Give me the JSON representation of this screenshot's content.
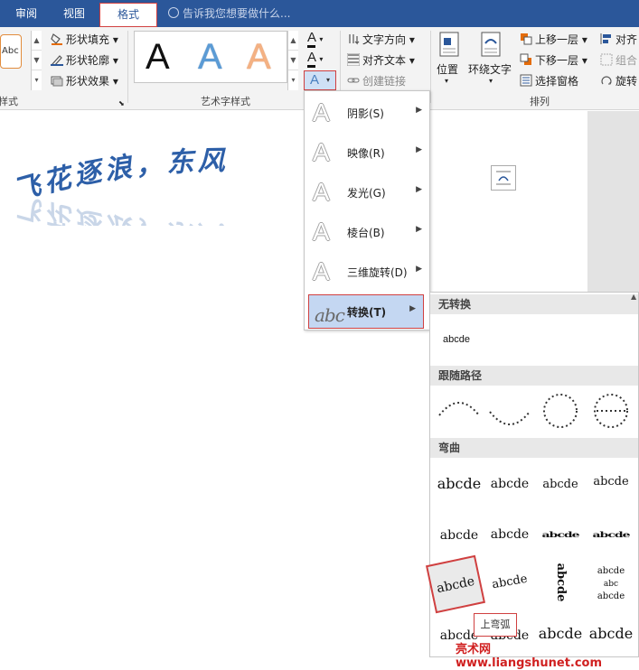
{
  "tabs": [
    {
      "label": "审阅"
    },
    {
      "label": "视图"
    },
    {
      "label": "格式"
    }
  ],
  "tellme": {
    "text": "告诉我您想要做什么..."
  },
  "shape_styles": {
    "preview_label": "Abc",
    "fill_label": "形状填充",
    "outline_label": "形状轮廓",
    "effects_label": "形状效果",
    "group_label": "样式"
  },
  "wordart_styles": {
    "samples": [
      "A",
      "A",
      "A"
    ],
    "group_label": "艺术字样式",
    "text_fill_glyph": "A",
    "text_outline_glyph": "A",
    "text_effects_glyph": "A"
  },
  "text_group": {
    "direction_label": "文字方向",
    "align_label": "对齐文本",
    "link_label": "创建链接"
  },
  "arrange": {
    "position_label": "位置",
    "wrap_label": "环绕文字",
    "forward_label": "上移一层",
    "backward_label": "下移一层",
    "selection_pane_label": "选择窗格",
    "align_label": "对齐",
    "group_label": "组合",
    "rotate_label": "旋转",
    "section_label": "排列"
  },
  "effects_menu": {
    "items": [
      {
        "label": "阴影(S)",
        "glyph": "A"
      },
      {
        "label": "映像(R)",
        "glyph": "A"
      },
      {
        "label": "发光(G)",
        "glyph": "A"
      },
      {
        "label": "棱台(B)",
        "glyph": "A"
      },
      {
        "label": "三维旋转(D)",
        "glyph": "A"
      },
      {
        "label": "转换(T)",
        "glyph": "abc"
      }
    ]
  },
  "transform_menu": {
    "no_transform_header": "无转换",
    "no_transform_sample": "abcde",
    "follow_path_header": "跟随路径",
    "warp_header": "弯曲",
    "warp_rows": [
      [
        "abcde",
        "abcde",
        "abcde",
        "abcde"
      ],
      [
        "abcde",
        "abcde",
        "abcde",
        "abcde"
      ],
      [
        "abcde",
        "abcde",
        "abcde",
        "abcde"
      ],
      [
        "abcde",
        "abcde",
        "abcde",
        "abcde"
      ]
    ],
    "tooltip": "上弯弧"
  },
  "document": {
    "wordart_text": "飞花逐浪，东风"
  },
  "watermark": "亮术网 www.liangshunet.com",
  "colors": {
    "ribbon_blue": "#2b579a",
    "highlight_red": "#d04040",
    "selected_bg": "#c4d7f2",
    "wordart_blue": "#2d5fa8"
  }
}
